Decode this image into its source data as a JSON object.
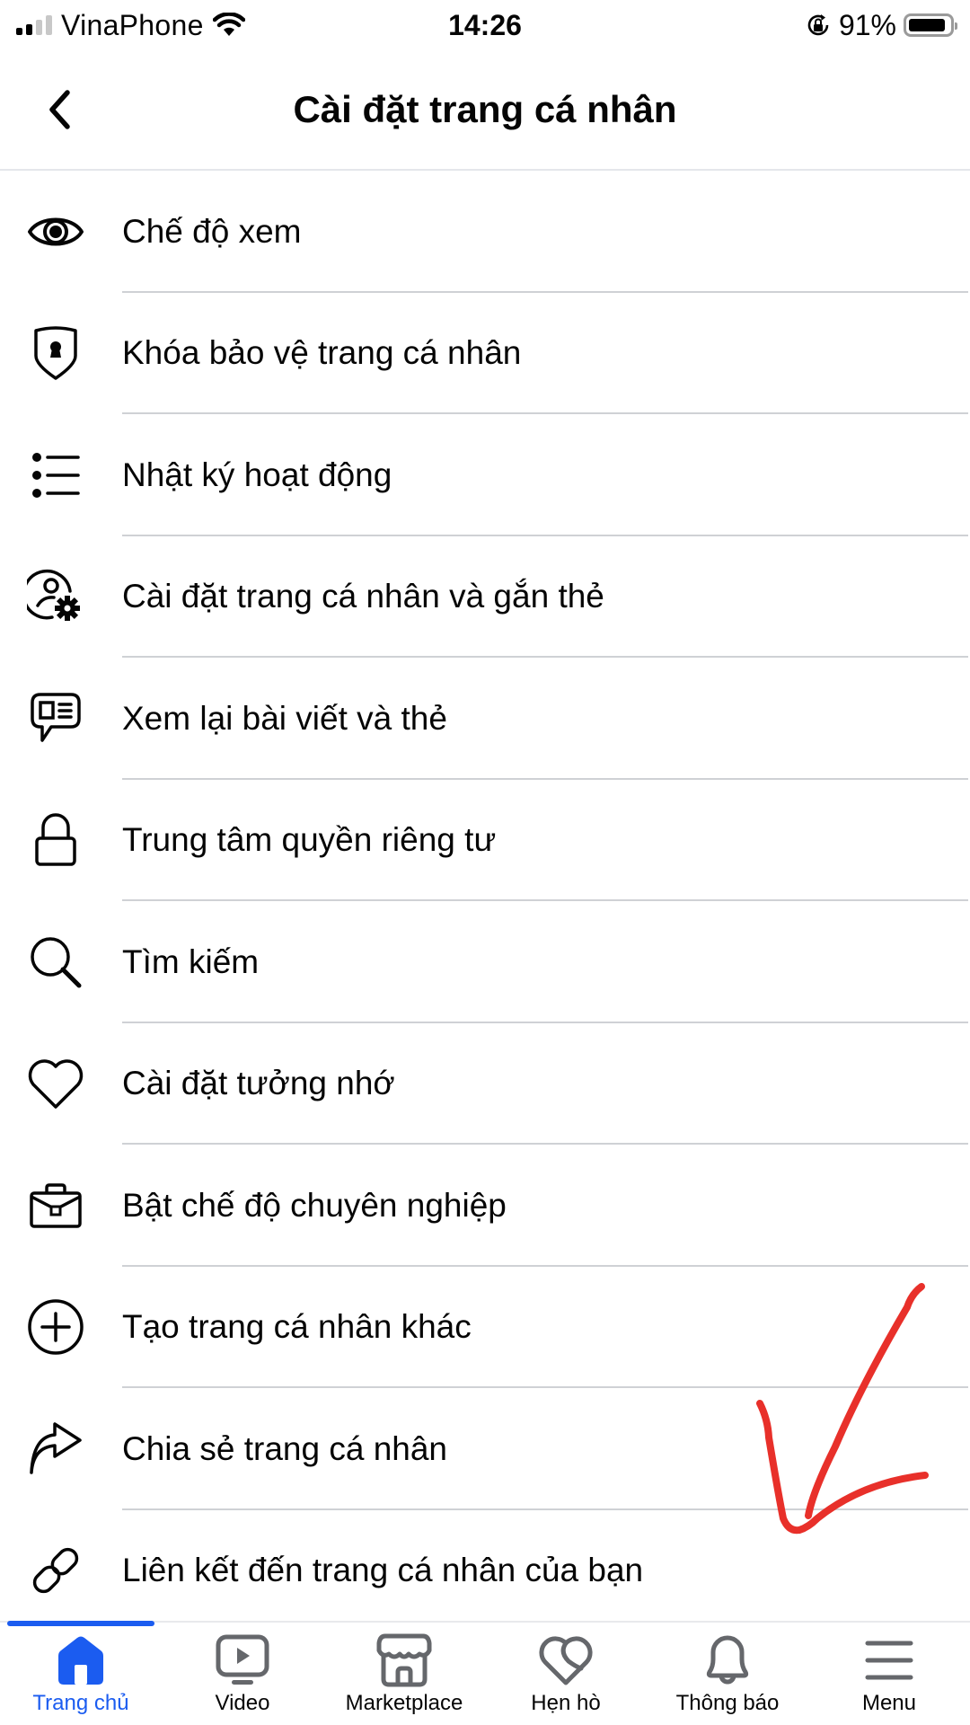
{
  "status_bar": {
    "carrier": "VinaPhone",
    "time": "14:26",
    "battery_percent": "91%",
    "battery_level": 0.91,
    "signal_bars_active": 2,
    "signal_bars_total": 4
  },
  "header": {
    "title": "Cài đặt trang cá nhân",
    "back_icon": "chevron-left-icon"
  },
  "menu": {
    "items": [
      {
        "label": "Chế độ xem",
        "icon": "eye-icon"
      },
      {
        "label": "Khóa bảo vệ trang cá nhân",
        "icon": "shield-lock-icon"
      },
      {
        "label": "Nhật ký hoạt động",
        "icon": "list-icon"
      },
      {
        "label": "Cài đặt trang cá nhân và gắn thẻ",
        "icon": "user-gear-icon"
      },
      {
        "label": "Xem lại bài viết và thẻ",
        "icon": "message-card-icon"
      },
      {
        "label": "Trung tâm quyền riêng tư",
        "icon": "lock-icon"
      },
      {
        "label": "Tìm kiếm",
        "icon": "search-icon"
      },
      {
        "label": "Cài đặt tưởng nhớ",
        "icon": "heart-icon"
      },
      {
        "label": "Bật chế độ chuyên nghiệp",
        "icon": "briefcase-icon"
      },
      {
        "label": "Tạo trang cá nhân khác",
        "icon": "plus-circle-icon"
      },
      {
        "label": "Chia sẻ trang cá nhân",
        "icon": "share-arrow-icon"
      },
      {
        "label": "Liên kết đến trang cá nhân của bạn",
        "icon": "link-icon"
      }
    ]
  },
  "annotation": {
    "type": "hand-drawn-arrow",
    "color": "#e8302a",
    "points_to": "Liên kết đến trang cá nhân của bạn"
  },
  "bottom_nav": {
    "active_color": "#1b5cf0",
    "icon_color": "#65676b",
    "items": [
      {
        "label": "Trang chủ",
        "icon": "home-icon",
        "active": true
      },
      {
        "label": "Video",
        "icon": "video-icon",
        "active": false
      },
      {
        "label": "Marketplace",
        "icon": "marketplace-icon",
        "active": false
      },
      {
        "label": "Hẹn hò",
        "icon": "dating-heart-icon",
        "active": false
      },
      {
        "label": "Thông báo",
        "icon": "bell-icon",
        "active": false
      },
      {
        "label": "Menu",
        "icon": "menu-icon",
        "active": false
      }
    ]
  }
}
